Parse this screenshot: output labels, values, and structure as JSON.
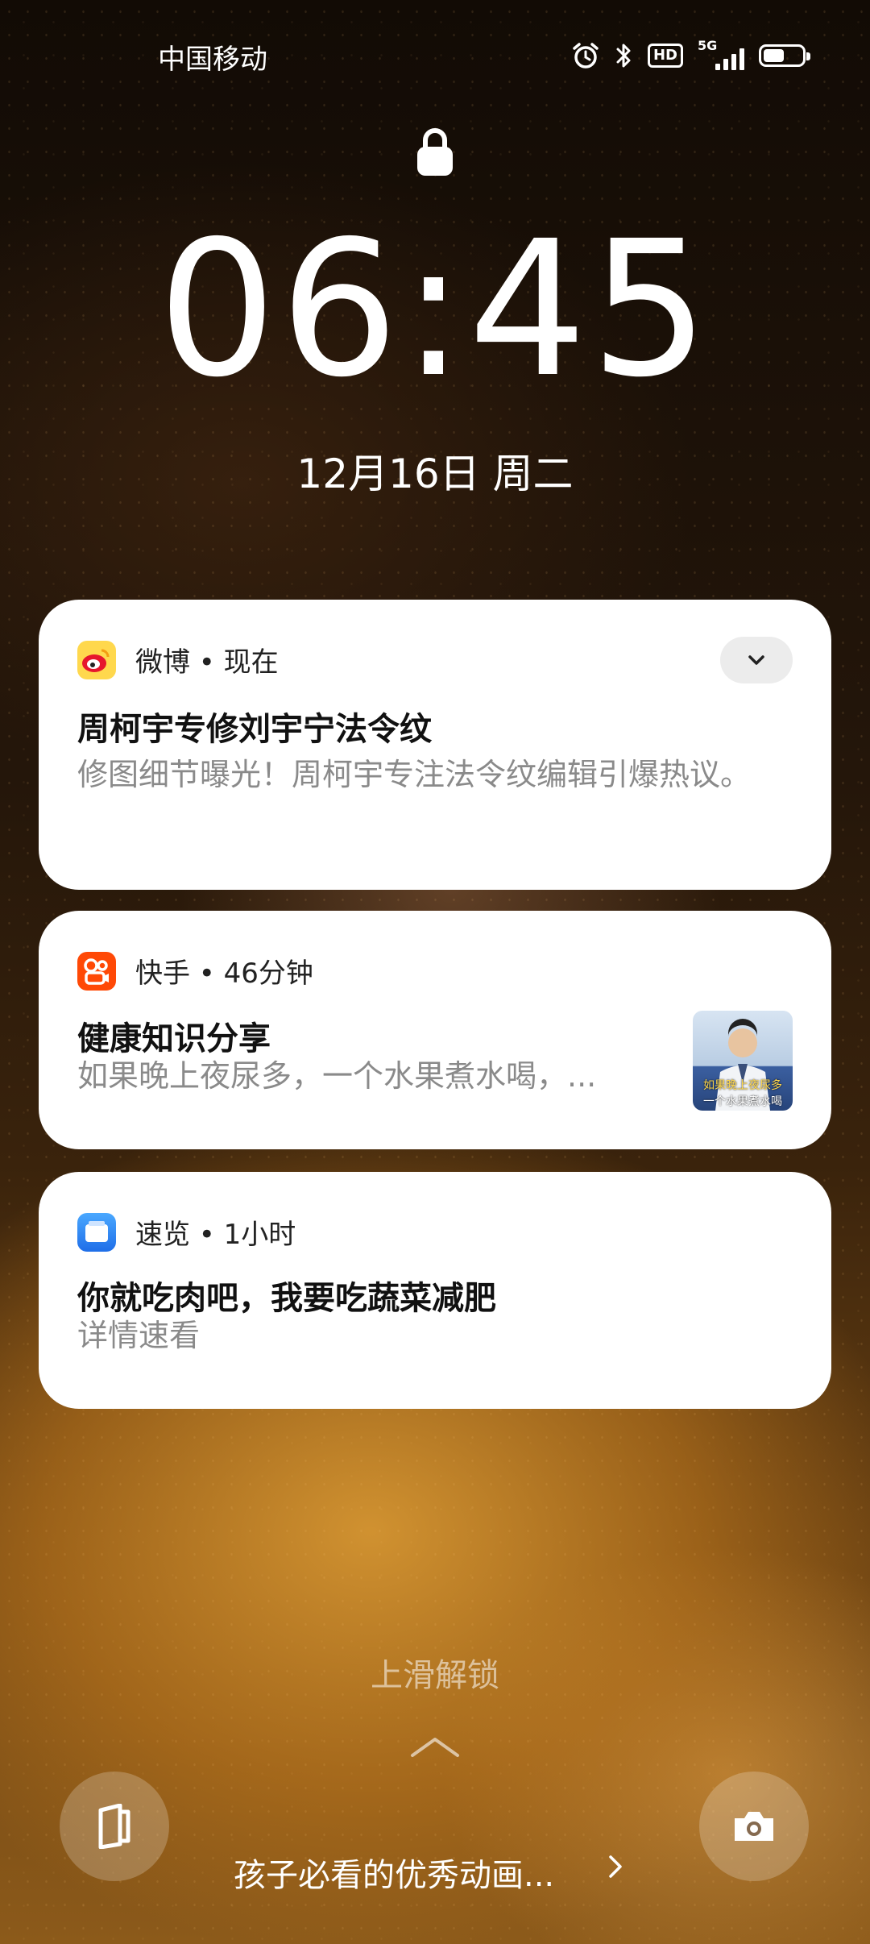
{
  "status_bar": {
    "carrier": "中国移动",
    "hd_label": "HD",
    "network_label": "5G",
    "battery_percent": 55,
    "icons": [
      "alarm-icon",
      "bluetooth-icon",
      "hd-icon",
      "signal-5g-icon",
      "battery-icon"
    ]
  },
  "lockscreen": {
    "time": "06:45",
    "date": "12月16日 周二",
    "lock_icon": "padlock-icon"
  },
  "notifications": [
    {
      "app": "微博",
      "time": "现在",
      "meta": "微博 • 现在",
      "title": "周柯宇专修刘宇宁法令纹",
      "body": "修图细节曝光！周柯宇专注法令纹编辑引爆热议。",
      "icon": "weibo-icon",
      "accent": "#e6162d",
      "has_expand": true
    },
    {
      "app": "快手",
      "time": "46分钟",
      "meta": "快手 • 46分钟",
      "title": "健康知识分享",
      "body": "如果晚上夜尿多，一个水果煮水喝，...",
      "icon": "kuaishou-icon",
      "accent": "#ff4906",
      "thumbnail_caption_top": "如果晚上夜尿多",
      "thumbnail_caption_bottom": "一个水果煮水喝"
    },
    {
      "app": "速览",
      "time": "1小时",
      "meta": "速览 • 1小时",
      "title": "你就吃肉吧，我要吃蔬菜减肥",
      "body": "详情速看",
      "icon": "sulan-icon",
      "accent": "#2f7cf6"
    }
  ],
  "bottom": {
    "unlock_hint": "上滑解锁",
    "music_title": "孩子必看的优秀动画...",
    "left_shortcut_icon": "wallet-icon",
    "right_shortcut_icon": "camera-icon"
  }
}
